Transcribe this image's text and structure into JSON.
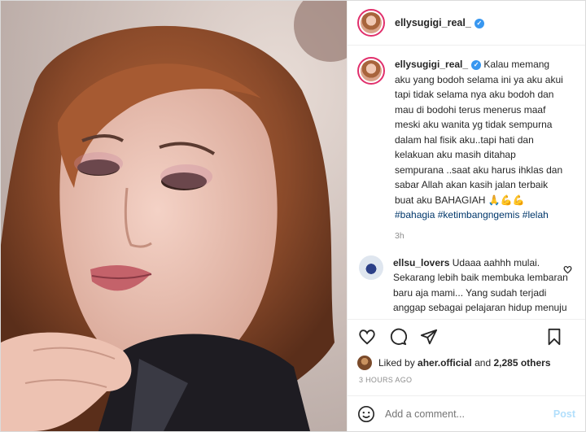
{
  "post": {
    "username": "ellysugigi_real_",
    "caption": "Kalau memang aku yang bodoh selama ini ya aku akui tapi tidak selama nya aku bodoh dan mau di bodohi terus menerus maaf meski aku wanita yg tidak sempurna dalam hal fisik aku..tapi hati dan kelakuan aku masih ditahap sempurana ..saat aku harus ihklas dan sabar Allah akan kasih jalan terbaik buat aku BAHAGIAH 🙏💪💪",
    "hashtags": "#bahagia #ketimbangngemis #lelah",
    "caption_time": "3h"
  },
  "comment": {
    "username": "ellsu_lovers",
    "text": "Udaaa aahhh mulai. Sekarang lebih baik membuka lembaran baru aja mami... Yang sudah terjadi anggap sebagai pelajaran hidup menuju yang lebih baik... Be strong mami ❤❤"
  },
  "likes": {
    "prefix": "Liked by",
    "by_user": "aher.official",
    "joiner": "and",
    "count": "2,285 others"
  },
  "timestamp": "3 HOURS AGO",
  "add_comment": {
    "placeholder": "Add a comment...",
    "post_label": "Post"
  },
  "icons": {
    "verified": "verified-badge-icon",
    "like": "heart-icon",
    "comment": "comment-icon",
    "share": "share-icon",
    "save": "bookmark-icon",
    "emoji": "emoji-icon"
  },
  "colors": {
    "verified": "#3897f0",
    "hashtag": "#00376b",
    "story_ring": "#e1306c",
    "post_disabled": "#b2dffc"
  }
}
